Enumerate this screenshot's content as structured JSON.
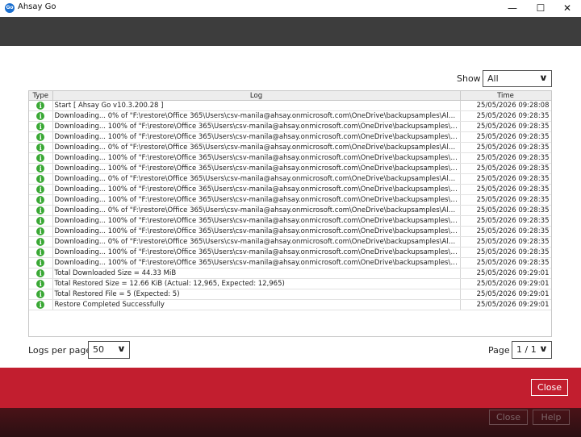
{
  "app": {
    "icon_text": "Go",
    "title": "Ahsay Go"
  },
  "window_controls": {
    "minimize": "—",
    "maximize": "☐",
    "close": "✕"
  },
  "filter": {
    "label": "Show",
    "selected": "All"
  },
  "table": {
    "headers": {
      "type": "Type",
      "log": "Log",
      "time": "Time"
    },
    "rows": [
      {
        "type": "info",
        "log": "Start [ Ahsay Go v10.3.200.28 ]",
        "time": "25/05/2026 09:28:08"
      },
      {
        "type": "info",
        "log": "Downloading... 0% of \"F:\\restore\\Office 365\\Users\\csv-manila@ahsay.onmicrosoft.com\\OneDrive\\backupsamples\\AlertMess...",
        "time": "25/05/2026 09:28:35"
      },
      {
        "type": "info",
        "log": "Downloading... 100% of \"F:\\restore\\Office 365\\Users\\csv-manila@ahsay.onmicrosoft.com\\OneDrive\\backupsamples\\AlertMe...",
        "time": "25/05/2026 09:28:35"
      },
      {
        "type": "info",
        "log": "Downloading... 100% of \"F:\\restore\\Office 365\\Users\\csv-manila@ahsay.onmicrosoft.com\\OneDrive\\backupsamples\\AlertMe...",
        "time": "25/05/2026 09:28:35"
      },
      {
        "type": "info",
        "log": "Downloading... 0% of \"F:\\restore\\Office 365\\Users\\csv-manila@ahsay.onmicrosoft.com\\OneDrive\\backupsamples\\AlertMess...",
        "time": "25/05/2026 09:28:35"
      },
      {
        "type": "info",
        "log": "Downloading... 100% of \"F:\\restore\\Office 365\\Users\\csv-manila@ahsay.onmicrosoft.com\\OneDrive\\backupsamples\\AlertMe...",
        "time": "25/05/2026 09:28:35"
      },
      {
        "type": "info",
        "log": "Downloading... 100% of \"F:\\restore\\Office 365\\Users\\csv-manila@ahsay.onmicrosoft.com\\OneDrive\\backupsamples\\AlertMe...",
        "time": "25/05/2026 09:28:35"
      },
      {
        "type": "info",
        "log": "Downloading... 0% of \"F:\\restore\\Office 365\\Users\\csv-manila@ahsay.onmicrosoft.com\\OneDrive\\backupsamples\\AlertMess...",
        "time": "25/05/2026 09:28:35"
      },
      {
        "type": "info",
        "log": "Downloading... 100% of \"F:\\restore\\Office 365\\Users\\csv-manila@ahsay.onmicrosoft.com\\OneDrive\\backupsamples\\AlertMe...",
        "time": "25/05/2026 09:28:35"
      },
      {
        "type": "info",
        "log": "Downloading... 100% of \"F:\\restore\\Office 365\\Users\\csv-manila@ahsay.onmicrosoft.com\\OneDrive\\backupsamples\\AlertMe...",
        "time": "25/05/2026 09:28:35"
      },
      {
        "type": "info",
        "log": "Downloading... 0% of \"F:\\restore\\Office 365\\Users\\csv-manila@ahsay.onmicrosoft.com\\OneDrive\\backupsamples\\AlertMess...",
        "time": "25/05/2026 09:28:35"
      },
      {
        "type": "info",
        "log": "Downloading... 100% of \"F:\\restore\\Office 365\\Users\\csv-manila@ahsay.onmicrosoft.com\\OneDrive\\backupsamples\\AlertMe...",
        "time": "25/05/2026 09:28:35"
      },
      {
        "type": "info",
        "log": "Downloading... 100% of \"F:\\restore\\Office 365\\Users\\csv-manila@ahsay.onmicrosoft.com\\OneDrive\\backupsamples\\AlertMe...",
        "time": "25/05/2026 09:28:35"
      },
      {
        "type": "info",
        "log": "Downloading... 0% of \"F:\\restore\\Office 365\\Users\\csv-manila@ahsay.onmicrosoft.com\\OneDrive\\backupsamples\\AlertMess...",
        "time": "25/05/2026 09:28:35"
      },
      {
        "type": "info",
        "log": "Downloading... 100% of \"F:\\restore\\Office 365\\Users\\csv-manila@ahsay.onmicrosoft.com\\OneDrive\\backupsamples\\AlertMe...",
        "time": "25/05/2026 09:28:35"
      },
      {
        "type": "info",
        "log": "Downloading... 100% of \"F:\\restore\\Office 365\\Users\\csv-manila@ahsay.onmicrosoft.com\\OneDrive\\backupsamples\\AlertMe...",
        "time": "25/05/2026 09:28:35"
      },
      {
        "type": "info",
        "log": "Total Downloaded Size = 44.33 MiB",
        "time": "25/05/2026 09:29:01"
      },
      {
        "type": "info",
        "log": "Total Restored Size = 12.66 KiB (Actual: 12,965, Expected: 12,965)",
        "time": "25/05/2026 09:29:01"
      },
      {
        "type": "info",
        "log": "Total Restored File = 5 (Expected: 5)",
        "time": "25/05/2026 09:29:01"
      },
      {
        "type": "info",
        "log": "Restore Completed Successfully",
        "time": "25/05/2026 09:29:01"
      }
    ]
  },
  "pagination": {
    "logs_per_page_label": "Logs per page",
    "logs_per_page_value": "50",
    "page_label": "Page",
    "page_value": "1 / 1"
  },
  "actions": {
    "close_label": "Close"
  },
  "background_buttons": {
    "close_label": "Close",
    "help_label": "Help"
  },
  "colors": {
    "header_dark": "#3d3d3d",
    "accent_red": "#c21e2f",
    "info_green": "#3aa835"
  }
}
